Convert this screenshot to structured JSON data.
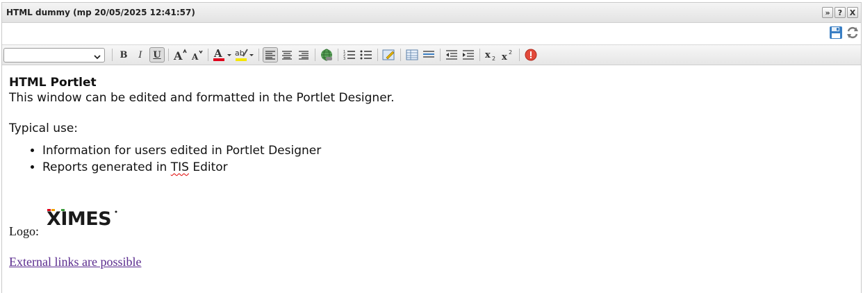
{
  "window": {
    "title": "HTML dummy (mp 20/05/2025 12:41:57)",
    "buttons": [
      "»",
      "?",
      "X"
    ]
  },
  "editor": {
    "font_select_value": ""
  },
  "content": {
    "heading": "HTML Portlet",
    "intro": "This window can be edited and formatted in the Portlet Designer.",
    "typical_use": "Typical use:",
    "list_item_1": "Information for users edited in Portlet Designer",
    "list_item_2_before": "Reports generated in ",
    "list_item_2_misspelled": "TIS",
    "list_item_2_after": " Editor",
    "logo_label": "Logo:",
    "logo_text": "XIMES",
    "link_text": "External links are possible"
  },
  "colors": {
    "font_color": "#e0001b",
    "highlight_color": "#f5e600",
    "link_color": "#5a2b8e"
  }
}
